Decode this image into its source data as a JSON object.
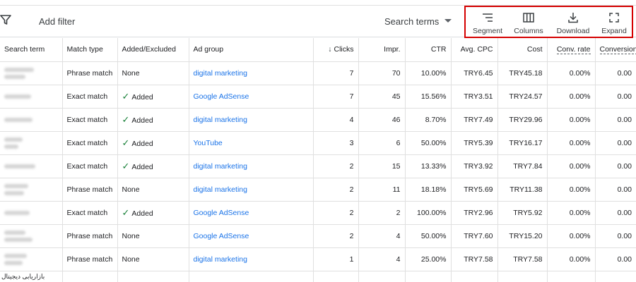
{
  "toolbar": {
    "add_filter": "Add filter",
    "view_select": "Search terms",
    "tools": [
      {
        "label": "Segment",
        "icon": "segment-icon"
      },
      {
        "label": "Columns",
        "icon": "columns-icon"
      },
      {
        "label": "Download",
        "icon": "download-icon"
      },
      {
        "label": "Expand",
        "icon": "expand-icon"
      }
    ]
  },
  "table": {
    "headers": {
      "search_term": "Search term",
      "match_type": "Match type",
      "added_excluded": "Added/Excluded",
      "ad_group": "Ad group",
      "clicks": "Clicks",
      "impr": "Impr.",
      "ctr": "CTR",
      "avg_cpc": "Avg. CPC",
      "cost": "Cost",
      "conv_rate": "Conv. rate",
      "conversions": "Conversions"
    },
    "rows": [
      {
        "match": "Phrase match",
        "status": "None",
        "added": false,
        "group": "digital marketing",
        "clicks": "7",
        "impr": "70",
        "ctr": "10.00%",
        "cpc": "TRY6.45",
        "cost": "TRY45.18",
        "conv_rate": "0.00%",
        "conv": "0.00"
      },
      {
        "match": "Exact match",
        "status": "Added",
        "added": true,
        "group": "Google AdSense",
        "clicks": "7",
        "impr": "45",
        "ctr": "15.56%",
        "cpc": "TRY3.51",
        "cost": "TRY24.57",
        "conv_rate": "0.00%",
        "conv": "0.00"
      },
      {
        "match": "Exact match",
        "status": "Added",
        "added": true,
        "group": "digital marketing",
        "clicks": "4",
        "impr": "46",
        "ctr": "8.70%",
        "cpc": "TRY7.49",
        "cost": "TRY29.96",
        "conv_rate": "0.00%",
        "conv": "0.00"
      },
      {
        "match": "Exact match",
        "status": "Added",
        "added": true,
        "group": "YouTube",
        "clicks": "3",
        "impr": "6",
        "ctr": "50.00%",
        "cpc": "TRY5.39",
        "cost": "TRY16.17",
        "conv_rate": "0.00%",
        "conv": "0.00"
      },
      {
        "match": "Exact match",
        "status": "Added",
        "added": true,
        "group": "digital marketing",
        "clicks": "2",
        "impr": "15",
        "ctr": "13.33%",
        "cpc": "TRY3.92",
        "cost": "TRY7.84",
        "conv_rate": "0.00%",
        "conv": "0.00"
      },
      {
        "match": "Phrase match",
        "status": "None",
        "added": false,
        "group": "digital marketing",
        "clicks": "2",
        "impr": "11",
        "ctr": "18.18%",
        "cpc": "TRY5.69",
        "cost": "TRY11.38",
        "conv_rate": "0.00%",
        "conv": "0.00"
      },
      {
        "match": "Exact match",
        "status": "Added",
        "added": true,
        "group": "Google AdSense",
        "clicks": "2",
        "impr": "2",
        "ctr": "100.00%",
        "cpc": "TRY2.96",
        "cost": "TRY5.92",
        "conv_rate": "0.00%",
        "conv": "0.00"
      },
      {
        "match": "Phrase match",
        "status": "None",
        "added": false,
        "group": "Google AdSense",
        "clicks": "2",
        "impr": "4",
        "ctr": "50.00%",
        "cpc": "TRY7.60",
        "cost": "TRY15.20",
        "conv_rate": "0.00%",
        "conv": "0.00"
      },
      {
        "match": "Phrase match",
        "status": "None",
        "added": false,
        "group": "digital marketing",
        "clicks": "1",
        "impr": "4",
        "ctr": "25.00%",
        "cpc": "TRY7.58",
        "cost": "TRY7.58",
        "conv_rate": "0.00%",
        "conv": "0.00"
      }
    ],
    "partial_row_term": "بازاریابی دیجیتال"
  },
  "colors": {
    "link": "#1a73e8",
    "added_check": "#188038",
    "highlight_box": "#d50000"
  }
}
